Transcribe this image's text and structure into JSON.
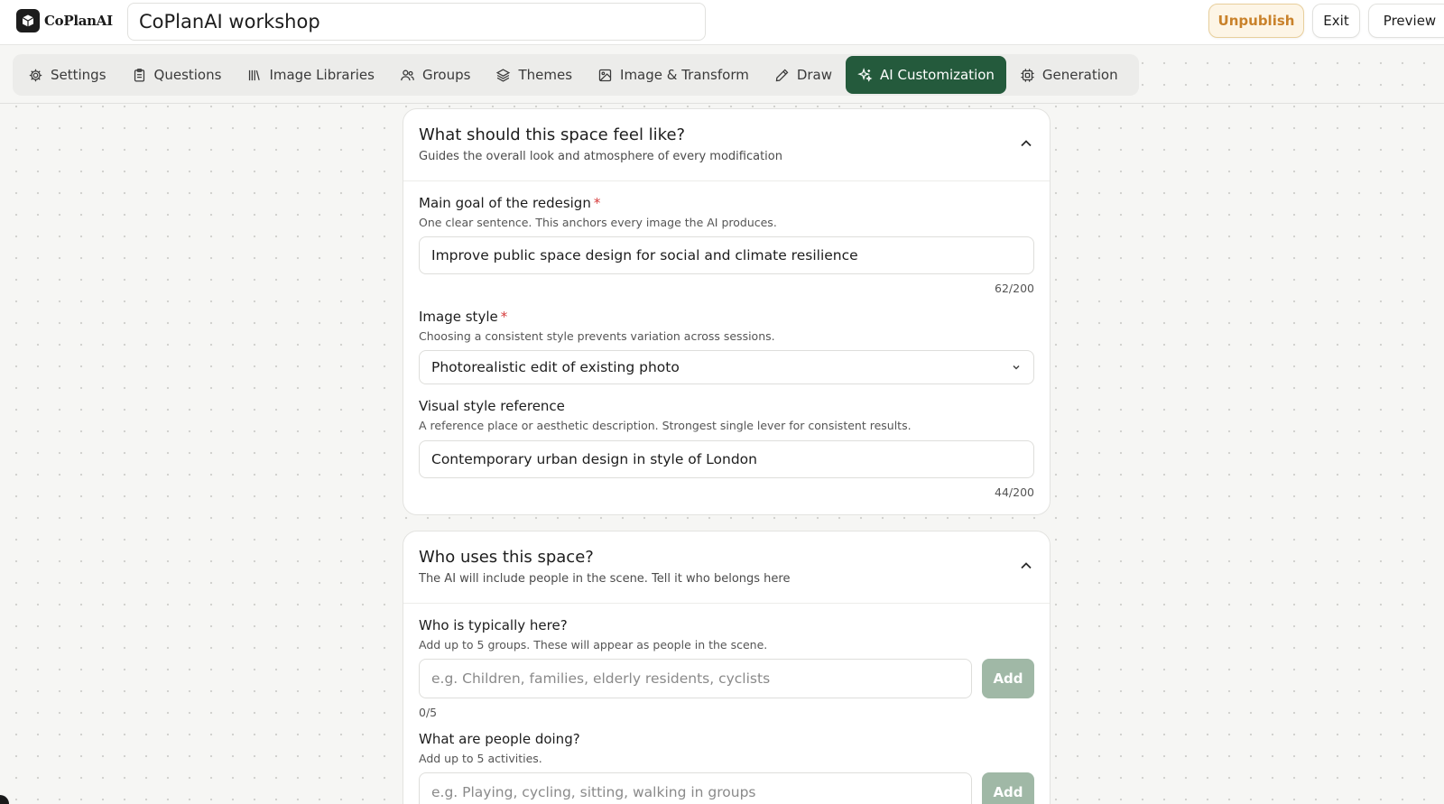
{
  "header": {
    "logo_text": "CoPlanAI",
    "title_value": "CoPlanAI workshop",
    "unpublish_label": "Unpublish",
    "exit_label": "Exit",
    "preview_label": "Preview"
  },
  "tabs": [
    {
      "label": "Settings",
      "icon": "gear-icon",
      "active": false
    },
    {
      "label": "Questions",
      "icon": "clipboard-icon",
      "active": false
    },
    {
      "label": "Image Libraries",
      "icon": "library-icon",
      "active": false
    },
    {
      "label": "Groups",
      "icon": "users-icon",
      "active": false
    },
    {
      "label": "Themes",
      "icon": "layers-icon",
      "active": false
    },
    {
      "label": "Image & Transform",
      "icon": "image-icon",
      "active": false
    },
    {
      "label": "Draw",
      "icon": "pencil-icon",
      "active": false
    },
    {
      "label": "AI Customization",
      "icon": "sparkles-icon",
      "active": true
    },
    {
      "label": "Generation",
      "icon": "chip-icon",
      "active": false
    }
  ],
  "colors": {
    "active_tab": "#245a3c",
    "unpublish_text": "#c9822b",
    "add_button": "#a0b8a6",
    "required": "#d63a3a"
  },
  "section_feel": {
    "title": "What should this space feel like?",
    "subtitle": "Guides the overall look and atmosphere of every modification",
    "goal": {
      "label": "Main goal of the redesign",
      "required_mark": "*",
      "help": "One clear sentence. This anchors every image the AI produces.",
      "value": "Improve public space design for social and climate resilience",
      "counter": "62/200"
    },
    "style": {
      "label": "Image style",
      "required_mark": "*",
      "help": "Choosing a consistent style prevents variation across sessions.",
      "selected": "Photorealistic edit of existing photo"
    },
    "reference": {
      "label": "Visual style reference",
      "help": "A reference place or aesthetic description. Strongest single lever for consistent results.",
      "value": "Contemporary urban design in style of London",
      "counter": "44/200"
    }
  },
  "section_users": {
    "title": "Who uses this space?",
    "subtitle": "The AI will include people in the scene. Tell it who belongs here",
    "who": {
      "label": "Who is typically here?",
      "help": "Add up to 5 groups. These will appear as people in the scene.",
      "placeholder": "e.g. Children, families, elderly residents, cyclists",
      "add_label": "Add",
      "count": "0/5"
    },
    "doing": {
      "label": "What are people doing?",
      "help": "Add up to 5 activities.",
      "placeholder": "e.g. Playing, cycling, sitting, walking in groups",
      "add_label": "Add"
    }
  }
}
